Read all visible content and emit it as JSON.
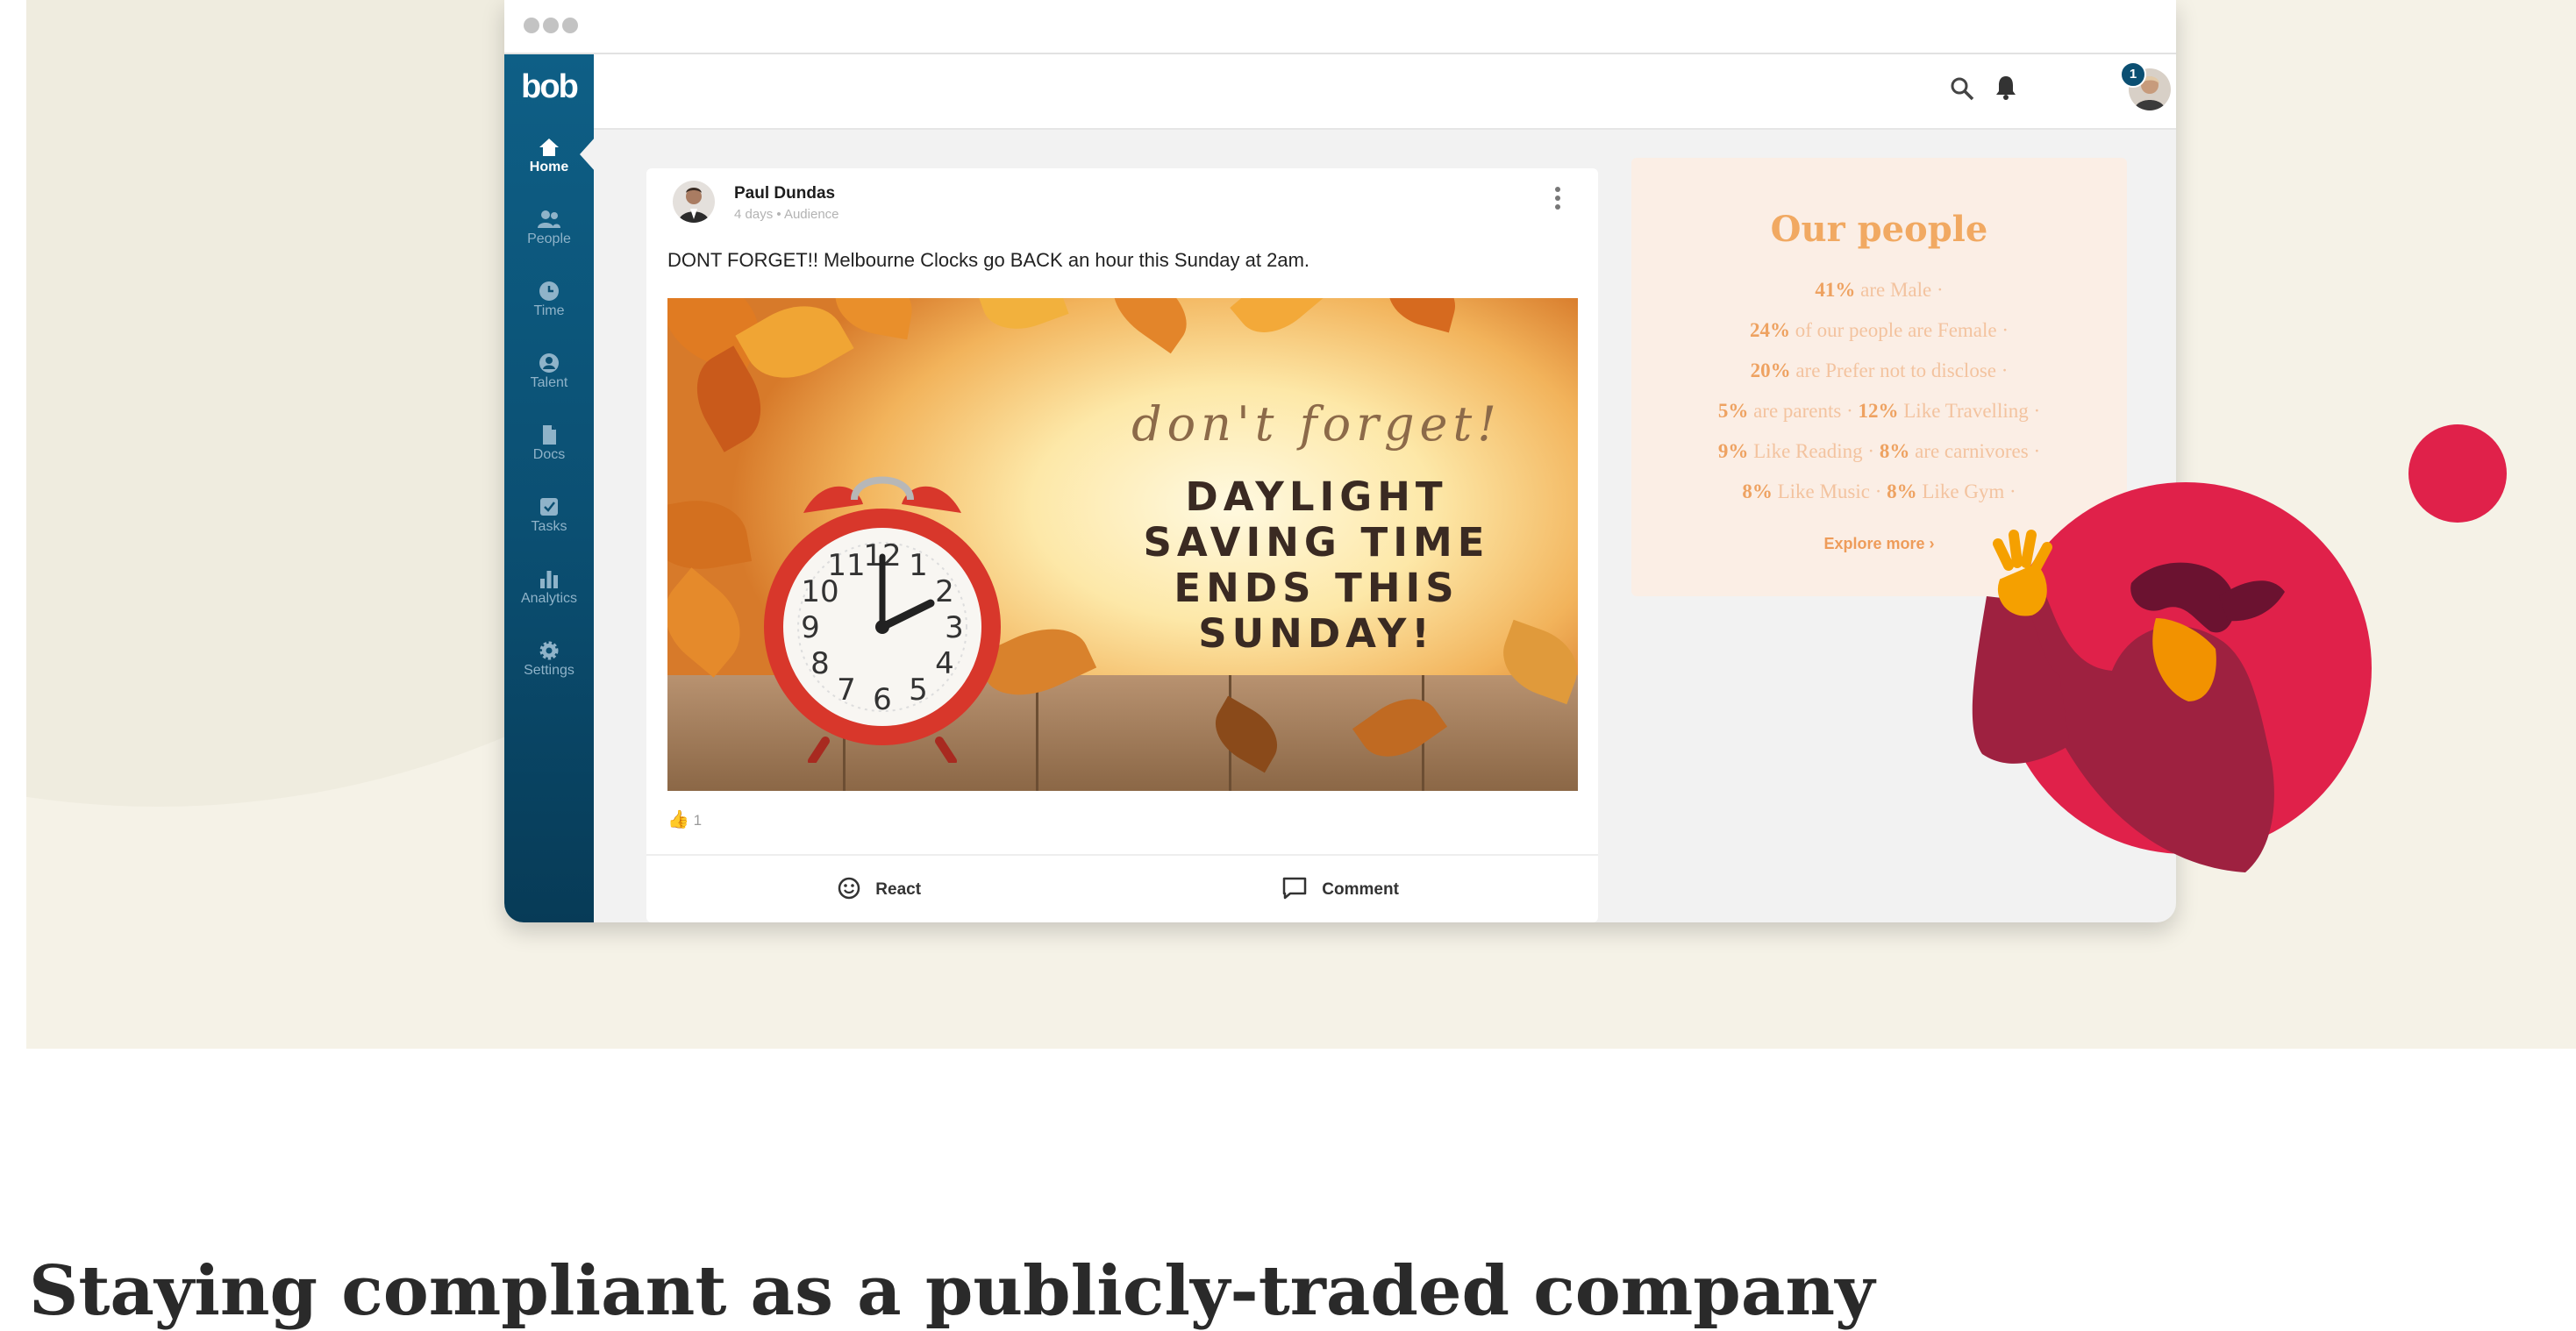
{
  "app": {
    "logo": "bob"
  },
  "sidebar": {
    "items": [
      {
        "label": "Home",
        "icon": "home-icon",
        "active": true
      },
      {
        "label": "People",
        "icon": "people-icon"
      },
      {
        "label": "Time",
        "icon": "clock-icon"
      },
      {
        "label": "Talent",
        "icon": "talent-icon"
      },
      {
        "label": "Docs",
        "icon": "document-icon"
      },
      {
        "label": "Tasks",
        "icon": "tasks-icon"
      },
      {
        "label": "Analytics",
        "icon": "analytics-icon"
      },
      {
        "label": "Settings",
        "icon": "settings-icon"
      }
    ]
  },
  "topbar": {
    "icons": [
      "search-icon",
      "bell-icon",
      "avatar",
      "collapse-icon"
    ],
    "notification_count": "1"
  },
  "post": {
    "author": "Paul Dundas",
    "meta": "4 days • Audience",
    "text": "DONT FORGET!! Melbourne Clocks go BACK an hour this Sunday at 2am.",
    "image": {
      "script_text": "don't forget!",
      "lines": [
        "DAYLIGHT",
        "SAVING TIME",
        "ENDS THIS",
        "SUNDAY!"
      ],
      "clock_numbers": [
        "12",
        "1",
        "2",
        "3",
        "4",
        "5",
        "6",
        "7",
        "8",
        "9",
        "10",
        "11"
      ]
    },
    "reaction_emoji": "👍",
    "reaction_count": "1",
    "react_label": "React",
    "comment_label": "Comment"
  },
  "people_panel": {
    "title": "Our people",
    "lines": [
      [
        {
          "value": "41%",
          "text": " are Male ·"
        }
      ],
      [
        {
          "value": "24%",
          "text": " of our people are Female ·"
        }
      ],
      [
        {
          "value": "20%",
          "text": " are Prefer not to disclose ·"
        }
      ],
      [
        {
          "value": "5%",
          "text": " are parents · "
        },
        {
          "value": "12%",
          "text": " Like Travelling ·"
        }
      ],
      [
        {
          "value": "9%",
          "text": " Like Reading · "
        },
        {
          "value": "8%",
          "text": " are carnivores ·"
        }
      ],
      [
        {
          "value": "8%",
          "text": " Like Music · "
        },
        {
          "value": "8%",
          "text": " Like Gym ·"
        }
      ]
    ],
    "explore_label": "Explore more ›"
  },
  "colors": {
    "sidebar": "#0b4f72",
    "accent_red": "#e0214a",
    "panel_title": "#f1a962",
    "hero_bg": "#f5f2e7"
  },
  "page": {
    "heading": "Staying compliant as a publicly-traded company"
  }
}
